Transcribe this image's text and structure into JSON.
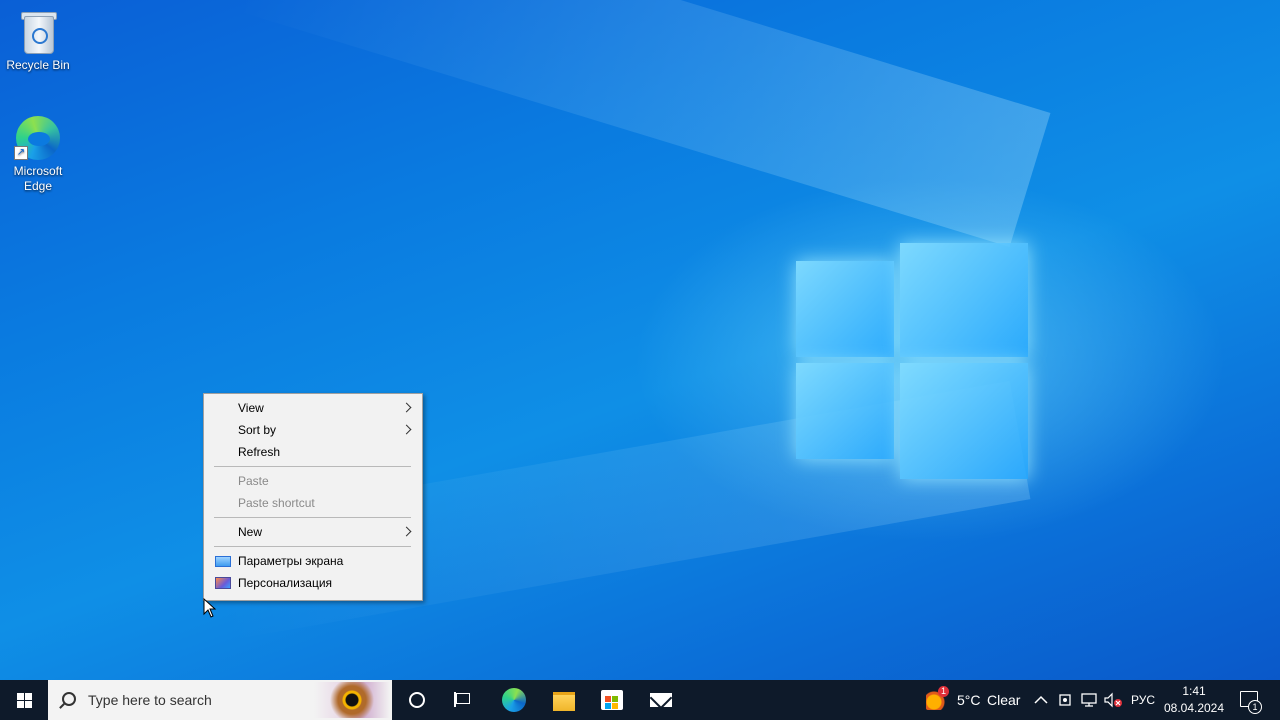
{
  "desktop": {
    "icons": [
      {
        "label": "Recycle Bin",
        "icon": "recycle-bin-icon"
      },
      {
        "label": "Microsoft\nEdge",
        "icon": "edge-icon"
      }
    ]
  },
  "context_menu": {
    "items": [
      {
        "label": "View",
        "submenu": true,
        "enabled": true
      },
      {
        "label": "Sort by",
        "submenu": true,
        "enabled": true
      },
      {
        "label": "Refresh",
        "submenu": false,
        "enabled": true
      },
      {
        "label": "Paste",
        "submenu": false,
        "enabled": false
      },
      {
        "label": "Paste shortcut",
        "submenu": false,
        "enabled": false
      },
      {
        "label": "New",
        "submenu": true,
        "enabled": true
      },
      {
        "label": "Параметры экрана",
        "submenu": false,
        "enabled": true,
        "icon": "display-settings-icon"
      },
      {
        "label": "Персонализация",
        "submenu": false,
        "enabled": true,
        "icon": "personalization-icon"
      }
    ]
  },
  "taskbar": {
    "search_placeholder": "Type here to search",
    "pinned": [
      "cortana-icon",
      "task-view-icon",
      "edge-icon",
      "file-explorer-icon",
      "store-icon",
      "mail-icon"
    ],
    "weather": {
      "temp": "5°C",
      "condition": "Clear",
      "badge": "1"
    },
    "language": "РУС",
    "time": "1:41",
    "date": "08.04.2024",
    "notifications_count": "1"
  },
  "colors": {
    "desktop_blue": "#0a7be0",
    "taskbar_bg": "#0e1a2a",
    "menu_bg": "#f2f2f2",
    "disabled_text": "#8a8a8a"
  }
}
